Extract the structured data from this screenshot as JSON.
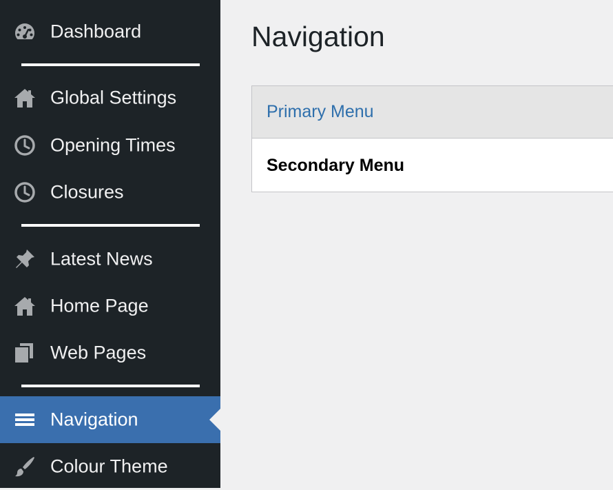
{
  "sidebar": {
    "items": [
      {
        "label": "Dashboard",
        "icon": "dashboard-gauge-icon"
      },
      {
        "label": "Global Settings",
        "icon": "home-icon"
      },
      {
        "label": "Opening Times",
        "icon": "clock-icon"
      },
      {
        "label": "Closures",
        "icon": "clock-icon"
      },
      {
        "label": "Latest News",
        "icon": "pushpin-icon"
      },
      {
        "label": "Home Page",
        "icon": "home-icon"
      },
      {
        "label": "Web Pages",
        "icon": "pages-icon"
      },
      {
        "label": "Navigation",
        "icon": "menu-icon",
        "active": true
      },
      {
        "label": "Colour Theme",
        "icon": "paintbrush-icon"
      }
    ],
    "background": "#1d2327",
    "active_background": "#3a6fae"
  },
  "main": {
    "title": "Navigation",
    "menus": [
      {
        "label": "Primary Menu",
        "state": "hover",
        "color": "#2e6fac"
      },
      {
        "label": "Secondary Menu",
        "state": "selected",
        "color": "#000000"
      }
    ]
  }
}
